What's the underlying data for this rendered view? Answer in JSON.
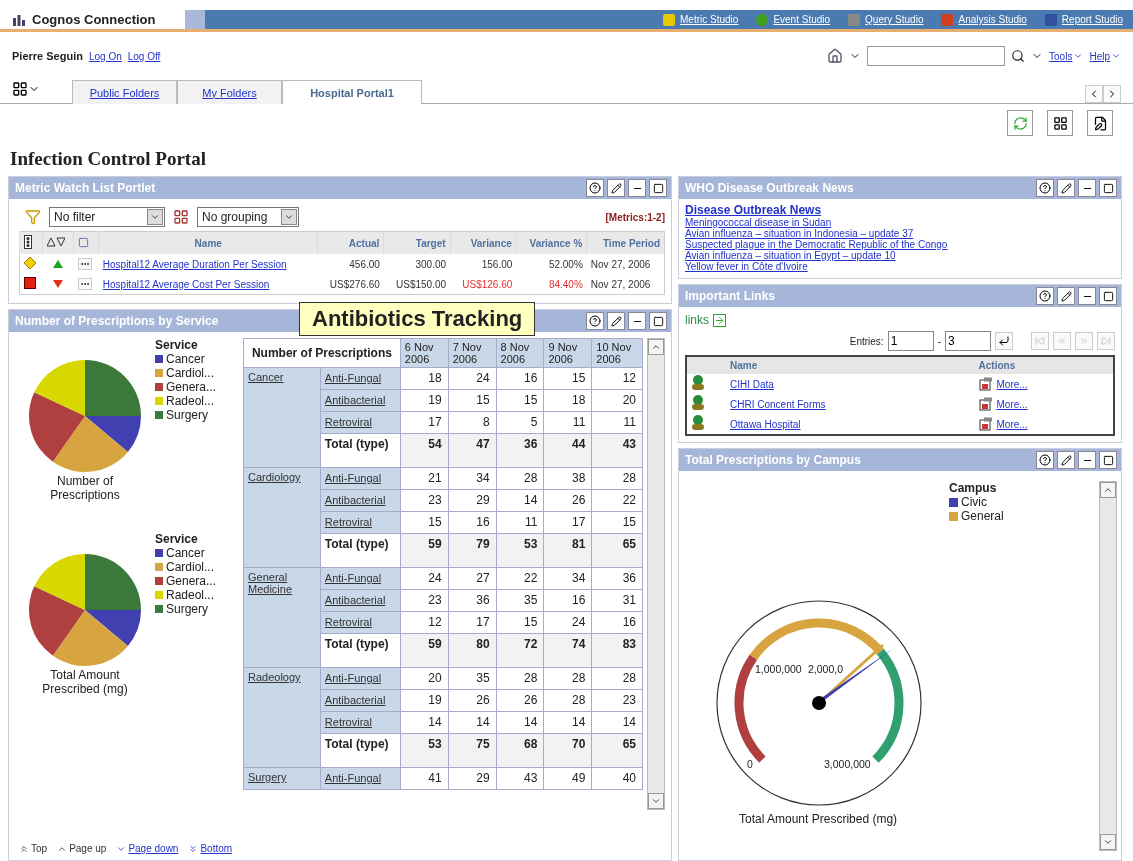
{
  "header": {
    "app_title": "Cognos Connection",
    "studios": [
      "Metric Studio",
      "Event Studio",
      "Query Studio",
      "Analysis Studio",
      "Report Studio"
    ]
  },
  "user": {
    "name": "Pierre Seguin",
    "links": [
      "Log On",
      "Log Off"
    ]
  },
  "menus": [
    "Tools",
    "Help"
  ],
  "tabs": [
    {
      "label": "Public Folders",
      "selected": false
    },
    {
      "label": "My Folders",
      "selected": false
    },
    {
      "label": "Hospital Portal1",
      "selected": true
    }
  ],
  "page_title": "Infection Control Portal",
  "callout": "Antibiotics Tracking",
  "metric_portlet": {
    "title": "Metric Watch List Portlet",
    "filter": "No filter",
    "grouping": "No grouping",
    "count": "[Metrics:1-2]",
    "columns": [
      "Name",
      "Actual",
      "Target",
      "Variance",
      "Variance %",
      "Time Period"
    ],
    "rows": [
      {
        "kind": "warning",
        "name": "Hospital12 Average Duration Per Session",
        "actual": "456.00",
        "target": "300.00",
        "variance": "156.00",
        "variance_pct": "52.00%",
        "period": "Nov 27, 2006"
      },
      {
        "kind": "critical",
        "name": "Hospital12 Average Cost Per Session",
        "actual": "US$276.60",
        "target": "US$150.00",
        "variance": "US$126.60",
        "variance_pct": "84.40%",
        "period": "Nov 27, 2006"
      }
    ]
  },
  "prescriptions_portlet": {
    "title": "Number of Prescriptions by Service",
    "pies": [
      {
        "legend_title": "Service",
        "caption": "Number of Prescriptions",
        "legend": [
          {
            "label": "Cancer",
            "color": "#4040b0"
          },
          {
            "label": "Cardiol...",
            "color": "#d8a440"
          },
          {
            "label": "Genera...",
            "color": "#b04040"
          },
          {
            "label": "Radeol...",
            "color": "#d8d800"
          },
          {
            "label": "Surgery",
            "color": "#3c7a3c"
          }
        ]
      },
      {
        "legend_title": "Service",
        "caption": "Total Amount Prescribed (mg)",
        "legend": [
          {
            "label": "Cancer",
            "color": "#4040b0"
          },
          {
            "label": "Cardiol...",
            "color": "#d8a440"
          },
          {
            "label": "Genera...",
            "color": "#b04040"
          },
          {
            "label": "Radeol...",
            "color": "#d8d800"
          },
          {
            "label": "Surgery",
            "color": "#3c7a3c"
          }
        ]
      }
    ],
    "table": {
      "corner": "Number of Prescriptions",
      "dates": [
        "6 Nov 2006",
        "7 Nov 2006",
        "8 Nov 2006",
        "9 Nov 2006",
        "10 Nov 2006"
      ],
      "groups": [
        {
          "service": "Cancer",
          "rows": [
            {
              "kind": "type",
              "label": "Anti-Fungal",
              "values": [
                "18",
                "24",
                "16",
                "15",
                "12"
              ]
            },
            {
              "kind": "type",
              "label": "Antibacterial",
              "values": [
                "19",
                "15",
                "15",
                "18",
                "20"
              ]
            },
            {
              "kind": "type",
              "label": "Retroviral",
              "values": [
                "17",
                "8",
                "5",
                "11",
                "11"
              ]
            },
            {
              "kind": "total",
              "label": "Total (type)",
              "values": [
                "54",
                "47",
                "36",
                "44",
                "43"
              ]
            }
          ]
        },
        {
          "service": "Cardiology",
          "rows": [
            {
              "kind": "type",
              "label": "Anti-Fungal",
              "values": [
                "21",
                "34",
                "28",
                "38",
                "28"
              ]
            },
            {
              "kind": "type",
              "label": "Antibacterial",
              "values": [
                "23",
                "29",
                "14",
                "26",
                "22"
              ]
            },
            {
              "kind": "type",
              "label": "Retroviral",
              "values": [
                "15",
                "16",
                "11",
                "17",
                "15"
              ]
            },
            {
              "kind": "total",
              "label": "Total (type)",
              "values": [
                "59",
                "79",
                "53",
                "81",
                "65"
              ]
            }
          ]
        },
        {
          "service": "General Medicine",
          "rows": [
            {
              "kind": "type",
              "label": "Anti-Fungal",
              "values": [
                "24",
                "27",
                "22",
                "34",
                "36"
              ]
            },
            {
              "kind": "type",
              "label": "Antibacterial",
              "values": [
                "23",
                "36",
                "35",
                "16",
                "31"
              ]
            },
            {
              "kind": "type",
              "label": "Retroviral",
              "values": [
                "12",
                "17",
                "15",
                "24",
                "16"
              ]
            },
            {
              "kind": "total",
              "label": "Total (type)",
              "values": [
                "59",
                "80",
                "72",
                "74",
                "83"
              ]
            }
          ]
        },
        {
          "service": "Radeology",
          "rows": [
            {
              "kind": "type",
              "label": "Anti-Fungal",
              "values": [
                "20",
                "35",
                "28",
                "28",
                "28"
              ]
            },
            {
              "kind": "type",
              "label": "Antibacterial",
              "values": [
                "19",
                "26",
                "26",
                "28",
                "23"
              ]
            },
            {
              "kind": "type",
              "label": "Retroviral",
              "values": [
                "14",
                "14",
                "14",
                "14",
                "14"
              ]
            },
            {
              "kind": "total",
              "label": "Total (type)",
              "values": [
                "53",
                "75",
                "68",
                "70",
                "65"
              ]
            }
          ]
        },
        {
          "service": "Surgery",
          "rows": [
            {
              "kind": "type",
              "label": "Anti-Fungal",
              "values": [
                "41",
                "29",
                "43",
                "49",
                "40"
              ]
            }
          ]
        }
      ]
    },
    "pager": [
      {
        "label": "Top",
        "disabled": true
      },
      {
        "label": "Page up",
        "disabled": true
      },
      {
        "label": "Page down",
        "disabled": false
      },
      {
        "label": "Bottom",
        "disabled": false
      }
    ]
  },
  "news_portlet": {
    "title": "WHO Disease Outbreak News",
    "heading": "Disease Outbreak News",
    "items": [
      "Meningococcal disease in Sudan",
      "Avian influenza – situation in Indonesia – update 37",
      "Suspected plague in the Democratic Republic of the Congo",
      "Avian influenza – situation in Egypt – update 10",
      "Yellow fever in Côte d'Ivoire"
    ]
  },
  "links_portlet": {
    "title": "Important Links",
    "label": "links",
    "entries_label": "Entries:",
    "from": "1",
    "separator": "-",
    "to": "3",
    "columns": [
      "Name",
      "Actions"
    ],
    "rows": [
      {
        "name": "CIHI Data",
        "action": "More..."
      },
      {
        "name": "CHRI Concent Forms",
        "action": "More..."
      },
      {
        "name": "Ottawa Hospital",
        "action": "More..."
      }
    ]
  },
  "campus_portlet": {
    "title": "Total Prescriptions by Campus",
    "legend_title": "Campus",
    "legend": [
      {
        "label": "Civic",
        "color": "#4040b0"
      },
      {
        "label": "General",
        "color": "#d8a440"
      }
    ],
    "ticks": [
      "1,000,000",
      "2,000,0",
      "0",
      "3,000,000"
    ],
    "caption": "Total Amount Prescribed (mg)"
  }
}
